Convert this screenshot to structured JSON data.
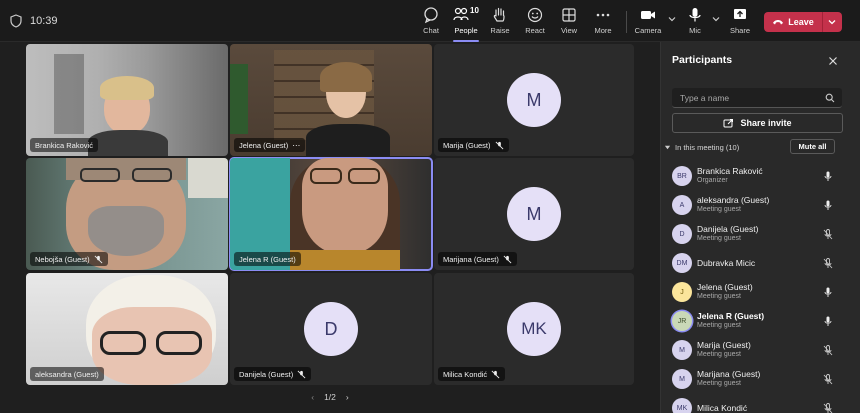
{
  "topbar": {
    "timer": "10:39",
    "people_count": "10",
    "buttons": {
      "chat": "Chat",
      "people": "People",
      "raise": "Raise",
      "react": "React",
      "view": "View",
      "more": "More",
      "camera": "Camera",
      "mic": "Mic",
      "share": "Share"
    },
    "leave": "Leave"
  },
  "stage": {
    "tiles": [
      {
        "name": "Brankica Raković",
        "type": "video"
      },
      {
        "name": "Jelena (Guest)",
        "type": "video"
      },
      {
        "name": "Marija (Guest)",
        "type": "avatar",
        "initials": "M"
      },
      {
        "name": "Nebojša (Guest)",
        "type": "video"
      },
      {
        "name": "Jelena R (Guest)",
        "type": "video"
      },
      {
        "name": "Marijana (Guest)",
        "type": "avatar",
        "initials": "M"
      },
      {
        "name": "aleksandra (Guest)",
        "type": "video"
      },
      {
        "name": "Danijela (Guest)",
        "type": "avatar",
        "initials": "D"
      },
      {
        "name": "Milica Kondić",
        "type": "avatar",
        "initials": "MK"
      }
    ],
    "pager": "1/2"
  },
  "panel": {
    "title": "Participants",
    "search_placeholder": "Type a name",
    "share_invite": "Share invite",
    "section_label": "In this meeting (10)",
    "mute_all": "Mute all",
    "participants": [
      {
        "initials": "BR",
        "name": "Brankica Raković",
        "role": "Organizer",
        "mic": "on"
      },
      {
        "initials": "A",
        "name": "aleksandra (Guest)",
        "role": "Meeting guest",
        "mic": "on"
      },
      {
        "initials": "D",
        "name": "Danijela (Guest)",
        "role": "Meeting guest",
        "mic": "muted"
      },
      {
        "initials": "DM",
        "name": "Dubravka Micic",
        "role": "",
        "mic": "muted"
      },
      {
        "initials": "J",
        "name": "Jelena (Guest)",
        "role": "Meeting guest",
        "mic": "on"
      },
      {
        "initials": "JR",
        "name": "Jelena R (Guest)",
        "role": "Meeting guest",
        "mic": "on"
      },
      {
        "initials": "M",
        "name": "Marija (Guest)",
        "role": "Meeting guest",
        "mic": "muted"
      },
      {
        "initials": "M",
        "name": "Marijana (Guest)",
        "role": "Meeting guest",
        "mic": "muted"
      },
      {
        "initials": "MK",
        "name": "Milica Kondić",
        "role": "",
        "mic": "muted"
      }
    ]
  },
  "colors": {
    "accent": "#8b8cf3",
    "leave": "#c4314b",
    "avatar_bg": "#e5e0f7"
  }
}
